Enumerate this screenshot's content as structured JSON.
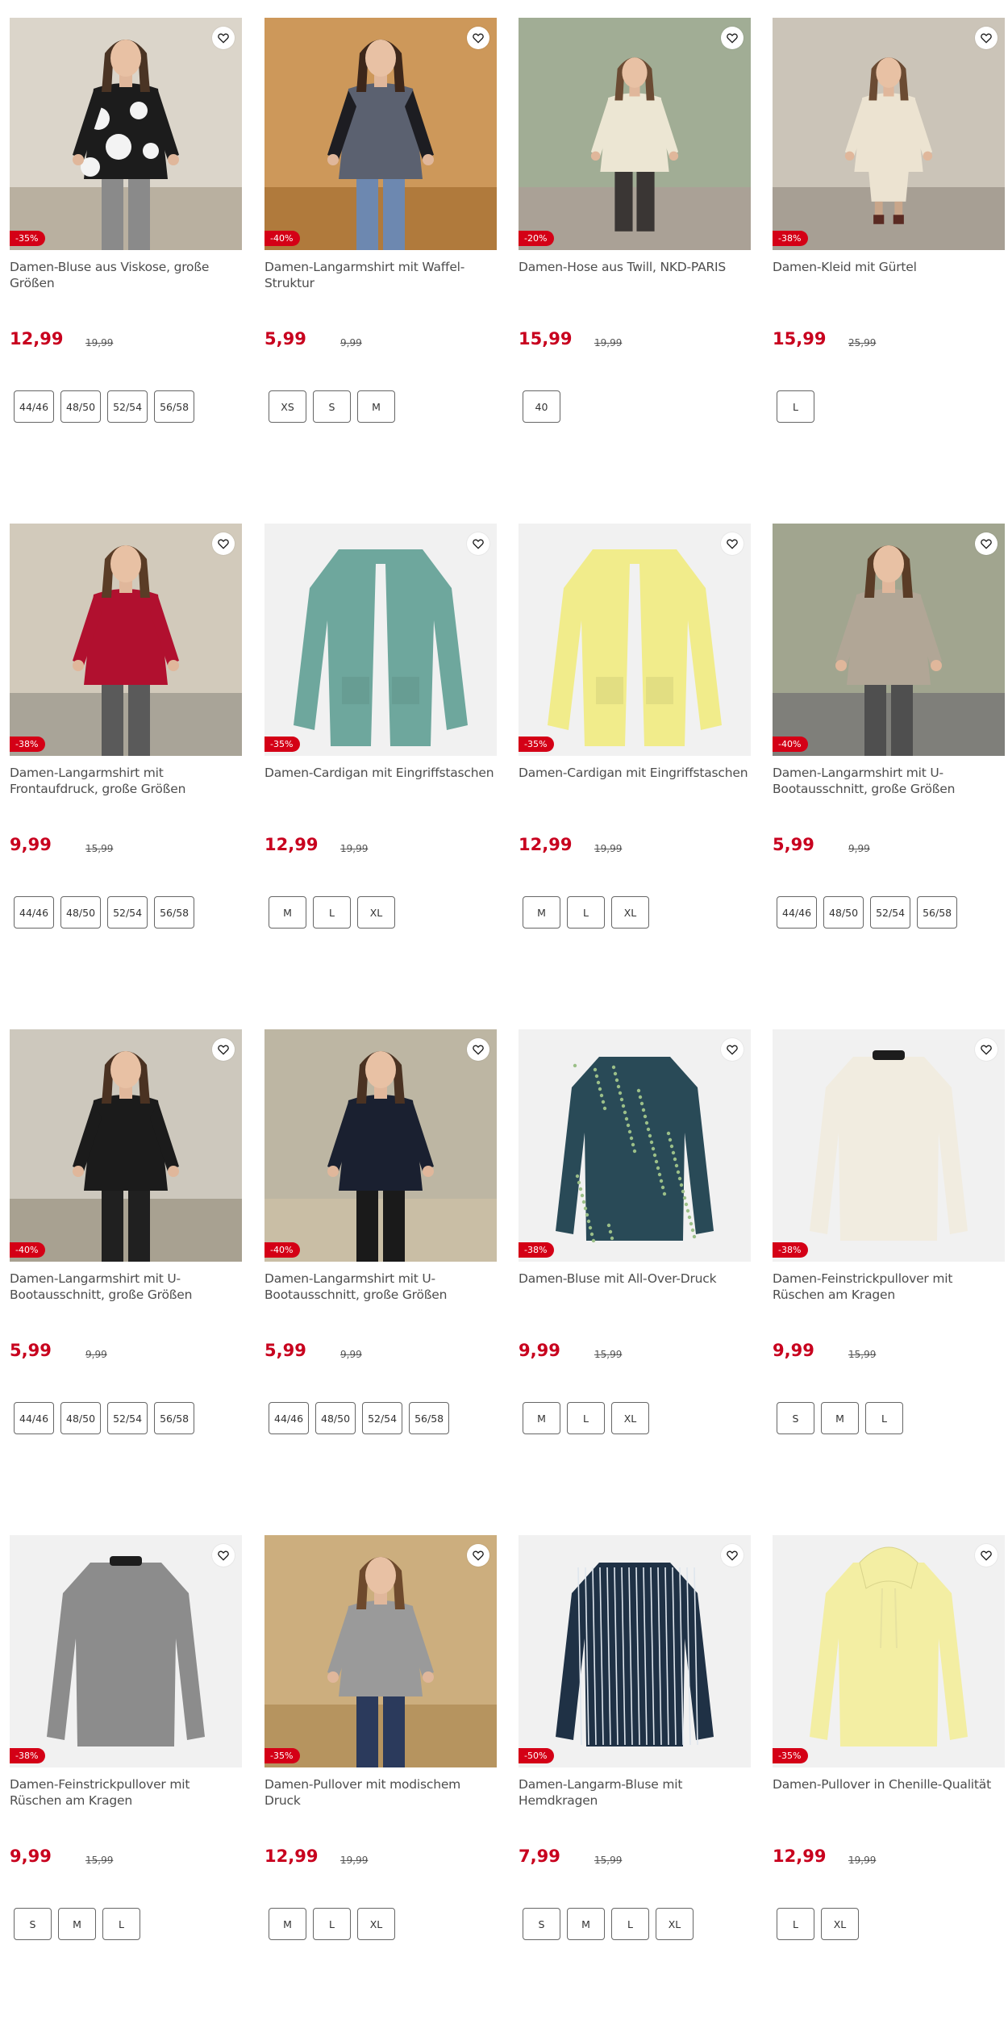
{
  "icons": {
    "wishlist": "heart-outline-icon"
  },
  "colors": {
    "accent_red": "#c8001e",
    "badge_red": "#d40016"
  },
  "products": [
    {
      "title": "Damen-Bluse aus Viskose, große Größen",
      "price": "12,99",
      "old_price": "19,99",
      "discount": "-35%",
      "sizes": [
        "44/46",
        "48/50",
        "52/54",
        "56/58"
      ],
      "image": "woman in black-and-white patterned blouse"
    },
    {
      "title": "Damen-Langarmshirt mit Waffel-Struktur",
      "price": "5,99",
      "old_price": "9,99",
      "discount": "-40%",
      "sizes": [
        "XS",
        "S",
        "M"
      ],
      "image": "woman in grey waffle shirt with black sleeves"
    },
    {
      "title": "Damen-Hose aus Twill, NKD-PARIS",
      "price": "15,99",
      "old_price": "19,99",
      "discount": "-20%",
      "sizes": [
        "40"
      ],
      "image": "woman in dark twill trousers and cream jacket"
    },
    {
      "title": "Damen-Kleid mit Gürtel",
      "price": "15,99",
      "old_price": "25,99",
      "discount": "-38%",
      "sizes": [
        "L"
      ],
      "image": "woman in cream dress with belt"
    },
    {
      "title": "Damen-Langarmshirt mit Frontaufdruck, große Größen",
      "price": "9,99",
      "old_price": "15,99",
      "discount": "-38%",
      "sizes": [
        "44/46",
        "48/50",
        "52/54",
        "56/58"
      ],
      "image": "woman in red long-sleeve shirt"
    },
    {
      "title": "Damen-Cardigan mit Eingriffstaschen",
      "price": "12,99",
      "old_price": "19,99",
      "discount": "-35%",
      "sizes": [
        "M",
        "L",
        "XL"
      ],
      "image": "teal open cardigan"
    },
    {
      "title": "Damen-Cardigan mit Eingriffstaschen",
      "price": "12,99",
      "old_price": "19,99",
      "discount": "-35%",
      "sizes": [
        "M",
        "L",
        "XL"
      ],
      "image": "yellow open cardigan"
    },
    {
      "title": "Damen-Langarmshirt mit U-Bootausschnitt, große Größen",
      "price": "5,99",
      "old_price": "9,99",
      "discount": "-40%",
      "sizes": [
        "44/46",
        "48/50",
        "52/54",
        "56/58"
      ],
      "image": "woman in taupe long-sleeve shirt"
    },
    {
      "title": "Damen-Langarmshirt mit U-Bootausschnitt, große Größen",
      "price": "5,99",
      "old_price": "9,99",
      "discount": "-40%",
      "sizes": [
        "44/46",
        "48/50",
        "52/54",
        "56/58"
      ],
      "image": "woman in black long-sleeve shirt"
    },
    {
      "title": "Damen-Langarmshirt mit U-Bootausschnitt, große Größen",
      "price": "5,99",
      "old_price": "9,99",
      "discount": "-40%",
      "sizes": [
        "44/46",
        "48/50",
        "52/54",
        "56/58"
      ],
      "image": "woman in navy long-sleeve shirt"
    },
    {
      "title": "Damen-Bluse mit All-Over-Druck",
      "price": "9,99",
      "old_price": "15,99",
      "discount": "-38%",
      "sizes": [
        "M",
        "L",
        "XL"
      ],
      "image": "dark teal printed blouse"
    },
    {
      "title": "Damen-Feinstrickpullover mit Rüschen am Kragen",
      "price": "9,99",
      "old_price": "15,99",
      "discount": "-38%",
      "sizes": [
        "S",
        "M",
        "L"
      ],
      "image": "cream knit sweater with ruffle collar"
    },
    {
      "title": "Damen-Feinstrickpullover mit Rüschen am Kragen",
      "price": "9,99",
      "old_price": "15,99",
      "discount": "-38%",
      "sizes": [
        "S",
        "M",
        "L"
      ],
      "image": "grey knit sweater with ruffle collar"
    },
    {
      "title": "Damen-Pullover mit modischem Druck",
      "price": "12,99",
      "old_price": "19,99",
      "discount": "-35%",
      "sizes": [
        "M",
        "L",
        "XL"
      ],
      "image": "woman in grey printed pullover"
    },
    {
      "title": "Damen-Langarm-Bluse mit Hemdkragen",
      "price": "7,99",
      "old_price": "15,99",
      "discount": "-50%",
      "sizes": [
        "S",
        "M",
        "L",
        "XL"
      ],
      "image": "navy striped blouse with shirt collar"
    },
    {
      "title": "Damen-Pullover in Chenille-Qualität",
      "price": "12,99",
      "old_price": "19,99",
      "discount": "-35%",
      "sizes": [
        "L",
        "XL"
      ],
      "image": "pale yellow chenille hoodie"
    }
  ]
}
